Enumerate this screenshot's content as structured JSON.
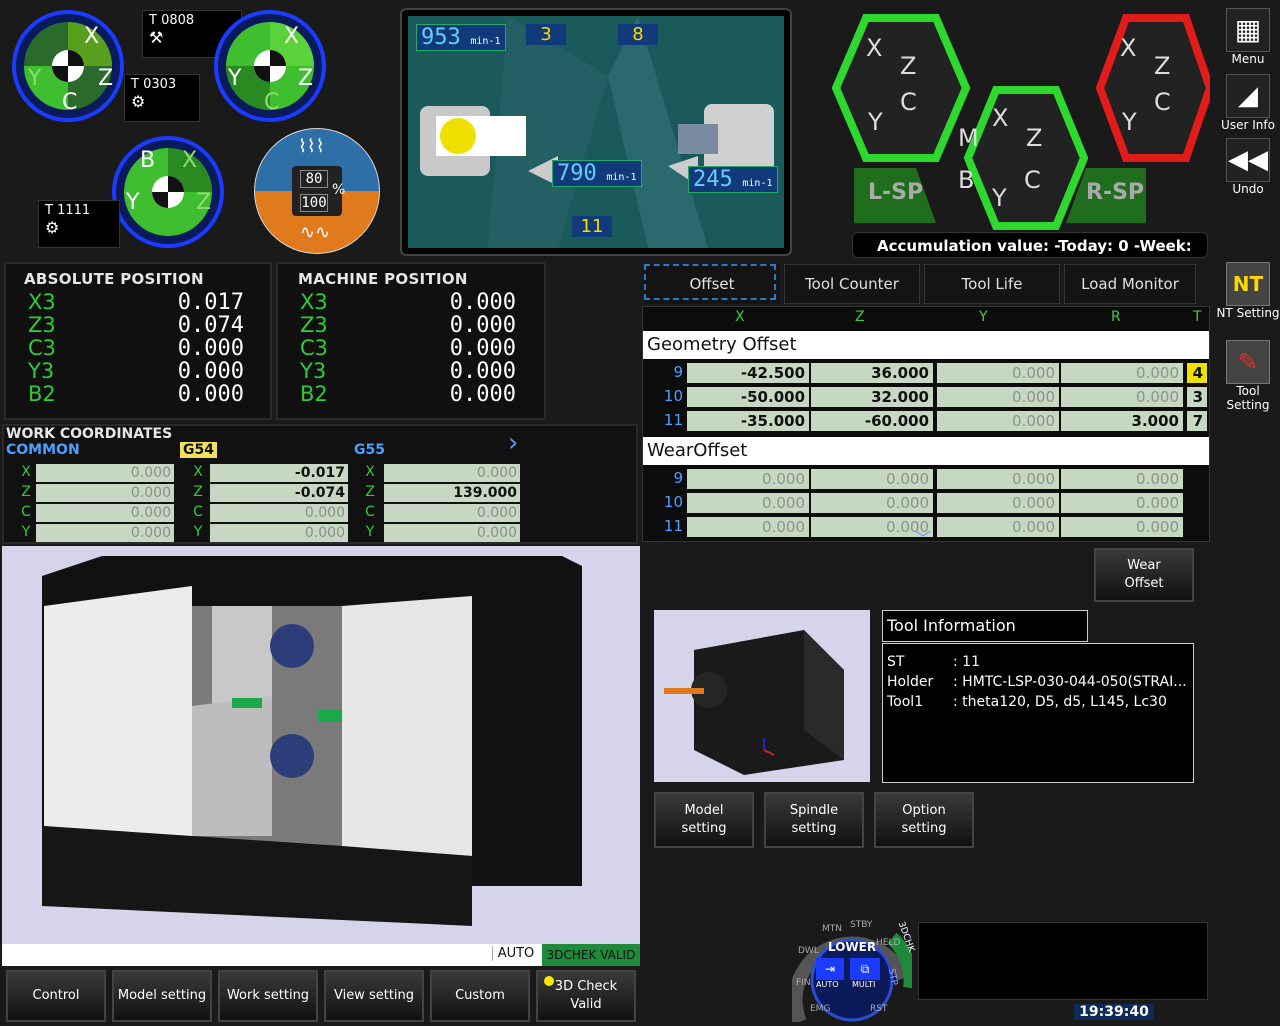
{
  "tools": {
    "t1": "T 0808",
    "t2": "T 0303",
    "t3": "T 1111"
  },
  "dials": {
    "d1": {
      "x": "X",
      "y": "Y",
      "z": "Z",
      "c": "C"
    },
    "d2": {
      "x": "X",
      "y": "Y",
      "z": "Z",
      "c": "C"
    },
    "d3": {
      "b": "B",
      "x": "X",
      "y": "Y",
      "z": "Z"
    }
  },
  "override": {
    "top": "80",
    "bottom": "100",
    "unit": "%"
  },
  "machine_view": {
    "rpm1": "953",
    "rpm1_unit": "min-1",
    "tool_a": "3",
    "tool_b": "8",
    "rpm2": "790",
    "rpm2_unit": "min-1",
    "rpm3": "245",
    "rpm3_unit": "min-1",
    "tool_c": "11"
  },
  "hex_status": {
    "h1": {
      "x": "X",
      "z": "Z",
      "c": "C",
      "y": "Y"
    },
    "h2": {
      "m": "M",
      "x": "X",
      "z": "Z",
      "b": "B",
      "c": "C",
      "y": "Y"
    },
    "h3": {
      "x": "X",
      "z": "Z",
      "c": "C",
      "y": "Y"
    },
    "lsp": "L-SP",
    "rsp": "R-SP"
  },
  "accumulation": "Accumulation value:  -Today:  0  -Week:",
  "absolute": {
    "title": "ABSOLUTE POSITION",
    "rows": [
      {
        "ax": "X3",
        "v": "0.017"
      },
      {
        "ax": "Z3",
        "v": "0.074"
      },
      {
        "ax": "C3",
        "v": "0.000"
      },
      {
        "ax": "Y3",
        "v": "0.000"
      },
      {
        "ax": "B2",
        "v": "0.000"
      }
    ]
  },
  "machine": {
    "title": "MACHINE POSITION",
    "rows": [
      {
        "ax": "X3",
        "v": "0.000"
      },
      {
        "ax": "Z3",
        "v": "0.000"
      },
      {
        "ax": "C3",
        "v": "0.000"
      },
      {
        "ax": "Y3",
        "v": "0.000"
      },
      {
        "ax": "B2",
        "v": "0.000"
      }
    ]
  },
  "work": {
    "title": "WORK COORDINATES",
    "common": "COMMON",
    "g54": "G54",
    "g55": "G55",
    "rows": [
      {
        "ax": "X",
        "common": "0.000",
        "g54": "-0.017",
        "g55": "0.000"
      },
      {
        "ax": "Z",
        "common": "0.000",
        "g54": "-0.074",
        "g55": "139.000"
      },
      {
        "ax": "C",
        "common": "0.000",
        "g54": "0.000",
        "g55": "0.000"
      },
      {
        "ax": "Y",
        "common": "0.000",
        "g54": "0.000",
        "g55": "0.000"
      }
    ]
  },
  "tabs": [
    "Offset",
    "Tool Counter",
    "Tool Life",
    "Load Monitor"
  ],
  "offset": {
    "cols": [
      "X",
      "Z",
      "Y",
      "R",
      "T"
    ],
    "geo_title": "Geometry Offset",
    "geo": [
      {
        "n": "9",
        "x": "-42.500",
        "z": "36.000",
        "y": "0.000",
        "r": "0.000",
        "t": "4"
      },
      {
        "n": "10",
        "x": "-50.000",
        "z": "32.000",
        "y": "0.000",
        "r": "0.000",
        "t": "3"
      },
      {
        "n": "11",
        "x": "-35.000",
        "z": "-60.000",
        "y": "0.000",
        "r": "3.000",
        "t": "7"
      }
    ],
    "wear_title": "WearOffset",
    "wear": [
      {
        "n": "9",
        "x": "0.000",
        "z": "0.000",
        "y": "0.000",
        "r": "0.000"
      },
      {
        "n": "10",
        "x": "0.000",
        "z": "0.000",
        "y": "0.000",
        "r": "0.000"
      },
      {
        "n": "11",
        "x": "0.000",
        "z": "0.000",
        "y": "0.000",
        "r": "0.000"
      }
    ]
  },
  "wear_offset_btn": "Wear\nOffset",
  "tool_info": {
    "title": "Tool Information",
    "l1k": "ST",
    "l1v": ": 11",
    "l2k": "Holder",
    "l2v": ": HMTC-LSP-030-044-050(STRAI...",
    "l3k": "Tool1",
    "l3v": ": theta120, D5, d5, L145, Lc30"
  },
  "settings_btns": [
    "Model\nsetting",
    "Spindle\nsetting",
    "Option\nsetting"
  ],
  "status": {
    "auto": "AUTO",
    "check": "3DCHEK VALID"
  },
  "bottom_btns": [
    "Control",
    "Model setting",
    "Work setting",
    "View setting",
    "Custom",
    "3D Check\nValid"
  ],
  "mode_dial": {
    "lower": "LOWER",
    "auto": "AUTO",
    "multi": "MULTI",
    "chk": "3DCHK",
    "stp": "STP",
    "rst": "RST",
    "emg": "EMG",
    "fin": "FIN",
    "dwl": "DWL",
    "mtn": "MTN",
    "stby": "STBY",
    "held": "HELD"
  },
  "clock": "19:39:40",
  "side": {
    "menu": "Menu",
    "user": "User Info",
    "undo": "Undo",
    "nt": "NT Setting",
    "tool": "Tool Setting"
  },
  "colors": {
    "green": "#2fcc39",
    "blue": "#4aa0ff",
    "red": "#e21b1b",
    "cell": "#c7d8c2"
  }
}
